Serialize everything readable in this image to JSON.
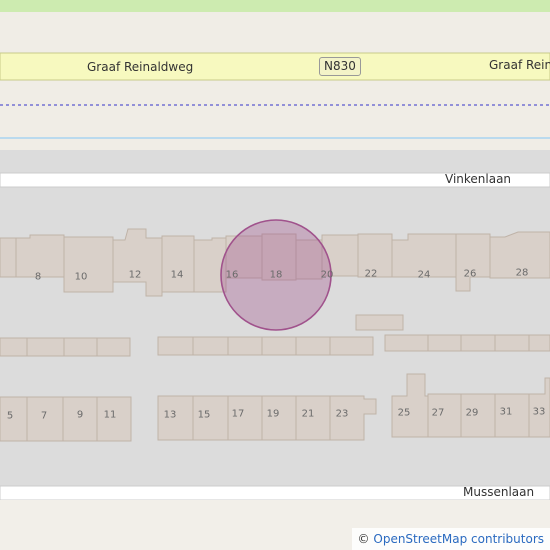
{
  "map": {
    "roads": {
      "main_road_name": "Graaf Reinaldweg",
      "main_road_name_right": "Graaf Reina",
      "route_shield": "N830",
      "north_street": "Vinkenlaan",
      "south_street": "Mussenlaan"
    },
    "house_numbers_north": [
      "8",
      "10",
      "12",
      "14",
      "16",
      "18",
      "20",
      "22",
      "24",
      "26",
      "28"
    ],
    "house_numbers_south": [
      "5",
      "7",
      "9",
      "11",
      "13",
      "15",
      "17",
      "19",
      "21",
      "23",
      "25",
      "27",
      "29",
      "31",
      "33"
    ],
    "highlight_color": "#a0528c",
    "highlighted_house_number": "18"
  },
  "attribution": {
    "symbol": "©",
    "text": "OpenStreetMap contributors"
  }
}
